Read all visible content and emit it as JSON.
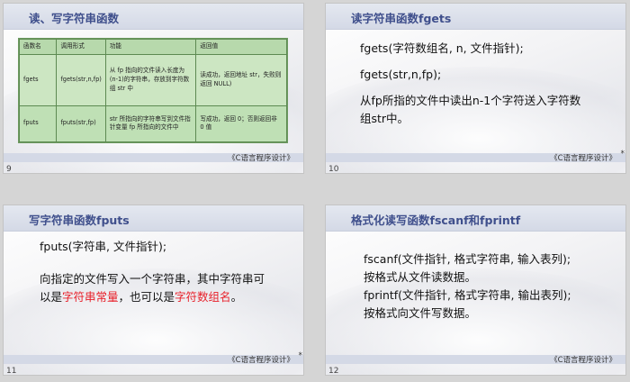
{
  "slides": [
    {
      "number": "9",
      "title": "读、写字符串函数",
      "footer": "《C语言程序设计》",
      "table": {
        "headers": [
          "函数名",
          "调用形式",
          "功能",
          "返回值"
        ],
        "rows": [
          [
            "fgets",
            "fgets(str,n,fp)",
            "从 fp 指向的文件读入长度为(n-1)的字符串，存放到字符数组 str 中",
            "读成功，返回地址 str，失败则返回 NULL)"
          ],
          [
            "fputs",
            "fputs(str,fp)",
            "str 所指向的字符串写到文件指针变量 fp 所指向的文件中",
            "写成功，返回 0；否则返回非 0 值"
          ]
        ]
      }
    },
    {
      "number": "10",
      "title": "读字符串函数fgets",
      "footer": "《C语言程序设计》",
      "star": "*",
      "lines": [
        "fgets(字符数组名, n, 文件指针);",
        "fgets(str,n,fp);",
        "从fp所指的文件中读出n-1个字符送入字符数",
        "组str中。"
      ]
    },
    {
      "number": "11",
      "title": "写字符串函数fputs",
      "footer": "《C语言程序设计》",
      "star": "*",
      "line1": "fputs(字符串, 文件指针);",
      "para_a": "向指定的文件写入一个字符串，其中字符串可",
      "para_b_prefix": "以是",
      "para_b_red1": "字符串常量",
      "para_b_mid": "，也可以是",
      "para_b_red2": "字符数组名",
      "para_b_suffix": "。"
    },
    {
      "number": "12",
      "title": "格式化读写函数fscanf和fprintf",
      "footer": "《C语言程序设计》",
      "lines": [
        "fscanf(文件指针, 格式字符串, 输入表列);",
        "按格式从文件读数据。",
        "fprintf(文件指针, 格式字符串, 输出表列);",
        "按格式向文件写数据。"
      ]
    }
  ]
}
